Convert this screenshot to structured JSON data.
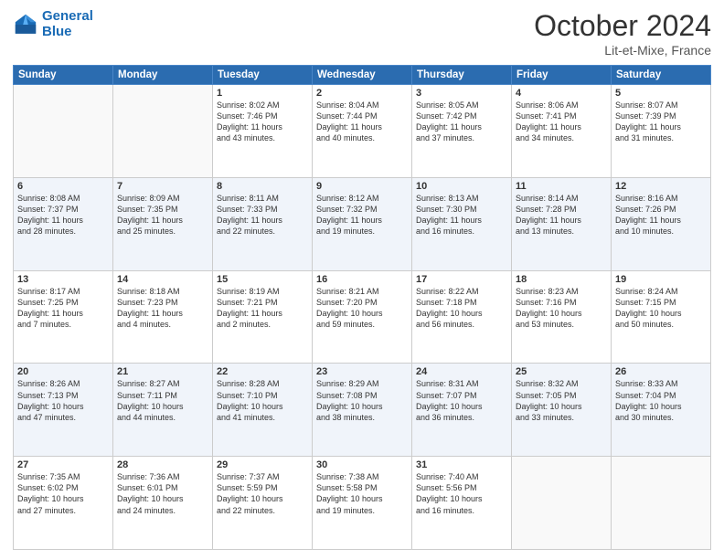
{
  "logo": {
    "line1": "General",
    "line2": "Blue"
  },
  "title": "October 2024",
  "location": "Lit-et-Mixe, France",
  "days_of_week": [
    "Sunday",
    "Monday",
    "Tuesday",
    "Wednesday",
    "Thursday",
    "Friday",
    "Saturday"
  ],
  "weeks": [
    [
      {
        "day": "",
        "info": ""
      },
      {
        "day": "",
        "info": ""
      },
      {
        "day": "1",
        "info": "Sunrise: 8:02 AM\nSunset: 7:46 PM\nDaylight: 11 hours\nand 43 minutes."
      },
      {
        "day": "2",
        "info": "Sunrise: 8:04 AM\nSunset: 7:44 PM\nDaylight: 11 hours\nand 40 minutes."
      },
      {
        "day": "3",
        "info": "Sunrise: 8:05 AM\nSunset: 7:42 PM\nDaylight: 11 hours\nand 37 minutes."
      },
      {
        "day": "4",
        "info": "Sunrise: 8:06 AM\nSunset: 7:41 PM\nDaylight: 11 hours\nand 34 minutes."
      },
      {
        "day": "5",
        "info": "Sunrise: 8:07 AM\nSunset: 7:39 PM\nDaylight: 11 hours\nand 31 minutes."
      }
    ],
    [
      {
        "day": "6",
        "info": "Sunrise: 8:08 AM\nSunset: 7:37 PM\nDaylight: 11 hours\nand 28 minutes."
      },
      {
        "day": "7",
        "info": "Sunrise: 8:09 AM\nSunset: 7:35 PM\nDaylight: 11 hours\nand 25 minutes."
      },
      {
        "day": "8",
        "info": "Sunrise: 8:11 AM\nSunset: 7:33 PM\nDaylight: 11 hours\nand 22 minutes."
      },
      {
        "day": "9",
        "info": "Sunrise: 8:12 AM\nSunset: 7:32 PM\nDaylight: 11 hours\nand 19 minutes."
      },
      {
        "day": "10",
        "info": "Sunrise: 8:13 AM\nSunset: 7:30 PM\nDaylight: 11 hours\nand 16 minutes."
      },
      {
        "day": "11",
        "info": "Sunrise: 8:14 AM\nSunset: 7:28 PM\nDaylight: 11 hours\nand 13 minutes."
      },
      {
        "day": "12",
        "info": "Sunrise: 8:16 AM\nSunset: 7:26 PM\nDaylight: 11 hours\nand 10 minutes."
      }
    ],
    [
      {
        "day": "13",
        "info": "Sunrise: 8:17 AM\nSunset: 7:25 PM\nDaylight: 11 hours\nand 7 minutes."
      },
      {
        "day": "14",
        "info": "Sunrise: 8:18 AM\nSunset: 7:23 PM\nDaylight: 11 hours\nand 4 minutes."
      },
      {
        "day": "15",
        "info": "Sunrise: 8:19 AM\nSunset: 7:21 PM\nDaylight: 11 hours\nand 2 minutes."
      },
      {
        "day": "16",
        "info": "Sunrise: 8:21 AM\nSunset: 7:20 PM\nDaylight: 10 hours\nand 59 minutes."
      },
      {
        "day": "17",
        "info": "Sunrise: 8:22 AM\nSunset: 7:18 PM\nDaylight: 10 hours\nand 56 minutes."
      },
      {
        "day": "18",
        "info": "Sunrise: 8:23 AM\nSunset: 7:16 PM\nDaylight: 10 hours\nand 53 minutes."
      },
      {
        "day": "19",
        "info": "Sunrise: 8:24 AM\nSunset: 7:15 PM\nDaylight: 10 hours\nand 50 minutes."
      }
    ],
    [
      {
        "day": "20",
        "info": "Sunrise: 8:26 AM\nSunset: 7:13 PM\nDaylight: 10 hours\nand 47 minutes."
      },
      {
        "day": "21",
        "info": "Sunrise: 8:27 AM\nSunset: 7:11 PM\nDaylight: 10 hours\nand 44 minutes."
      },
      {
        "day": "22",
        "info": "Sunrise: 8:28 AM\nSunset: 7:10 PM\nDaylight: 10 hours\nand 41 minutes."
      },
      {
        "day": "23",
        "info": "Sunrise: 8:29 AM\nSunset: 7:08 PM\nDaylight: 10 hours\nand 38 minutes."
      },
      {
        "day": "24",
        "info": "Sunrise: 8:31 AM\nSunset: 7:07 PM\nDaylight: 10 hours\nand 36 minutes."
      },
      {
        "day": "25",
        "info": "Sunrise: 8:32 AM\nSunset: 7:05 PM\nDaylight: 10 hours\nand 33 minutes."
      },
      {
        "day": "26",
        "info": "Sunrise: 8:33 AM\nSunset: 7:04 PM\nDaylight: 10 hours\nand 30 minutes."
      }
    ],
    [
      {
        "day": "27",
        "info": "Sunrise: 7:35 AM\nSunset: 6:02 PM\nDaylight: 10 hours\nand 27 minutes."
      },
      {
        "day": "28",
        "info": "Sunrise: 7:36 AM\nSunset: 6:01 PM\nDaylight: 10 hours\nand 24 minutes."
      },
      {
        "day": "29",
        "info": "Sunrise: 7:37 AM\nSunset: 5:59 PM\nDaylight: 10 hours\nand 22 minutes."
      },
      {
        "day": "30",
        "info": "Sunrise: 7:38 AM\nSunset: 5:58 PM\nDaylight: 10 hours\nand 19 minutes."
      },
      {
        "day": "31",
        "info": "Sunrise: 7:40 AM\nSunset: 5:56 PM\nDaylight: 10 hours\nand 16 minutes."
      },
      {
        "day": "",
        "info": ""
      },
      {
        "day": "",
        "info": ""
      }
    ]
  ]
}
